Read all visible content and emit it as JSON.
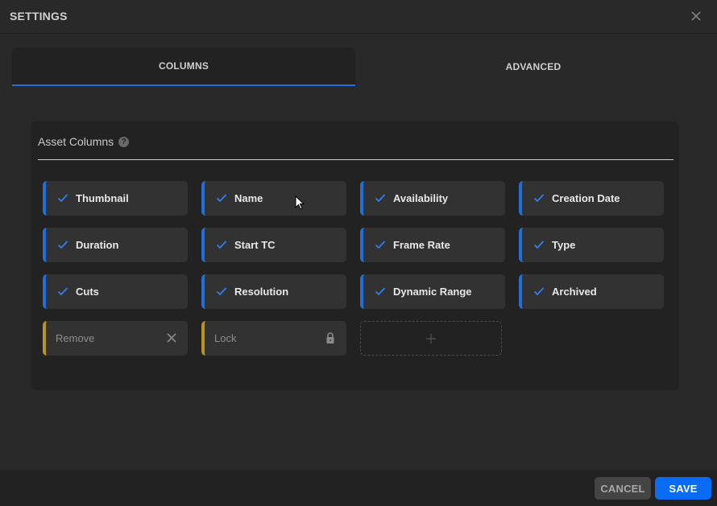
{
  "header": {
    "title": "SETTINGS",
    "close_icon": "close-icon"
  },
  "tabs": [
    {
      "label": "COLUMNS",
      "active": true
    },
    {
      "label": "ADVANCED",
      "active": false
    }
  ],
  "panel": {
    "title": "Asset Columns",
    "help_icon": "?",
    "columns": [
      {
        "label": "Thumbnail",
        "checked": true
      },
      {
        "label": "Name",
        "checked": true
      },
      {
        "label": "Availability",
        "checked": true
      },
      {
        "label": "Creation Date",
        "checked": true
      },
      {
        "label": "Duration",
        "checked": true
      },
      {
        "label": "Start TC",
        "checked": true
      },
      {
        "label": "Frame Rate",
        "checked": true
      },
      {
        "label": "Type",
        "checked": true
      },
      {
        "label": "Cuts",
        "checked": true
      },
      {
        "label": "Resolution",
        "checked": true
      },
      {
        "label": "Dynamic Range",
        "checked": true
      },
      {
        "label": "Archived",
        "checked": true
      }
    ],
    "actions": [
      {
        "label": "Remove",
        "icon": "close-icon"
      },
      {
        "label": "Lock",
        "icon": "lock-icon"
      }
    ],
    "add_icon": "plus-icon"
  },
  "footer": {
    "cancel_label": "CANCEL",
    "save_label": "SAVE"
  },
  "colors": {
    "accent": "#1f6fe0",
    "save": "#0a6cf5",
    "special": "#b8961e"
  }
}
